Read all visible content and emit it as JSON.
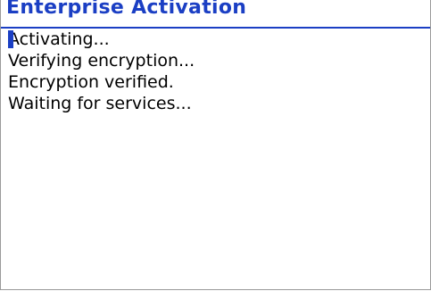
{
  "header": {
    "title": "Enterprise Activation"
  },
  "status_lines": [
    "Activating...",
    "Verifying encryption...",
    "Encryption verified.",
    "Waiting for services..."
  ],
  "colors": {
    "title": "#1b3fc4",
    "text": "#000000",
    "cursor": "#1b3fc4",
    "background": "#ffffff"
  }
}
